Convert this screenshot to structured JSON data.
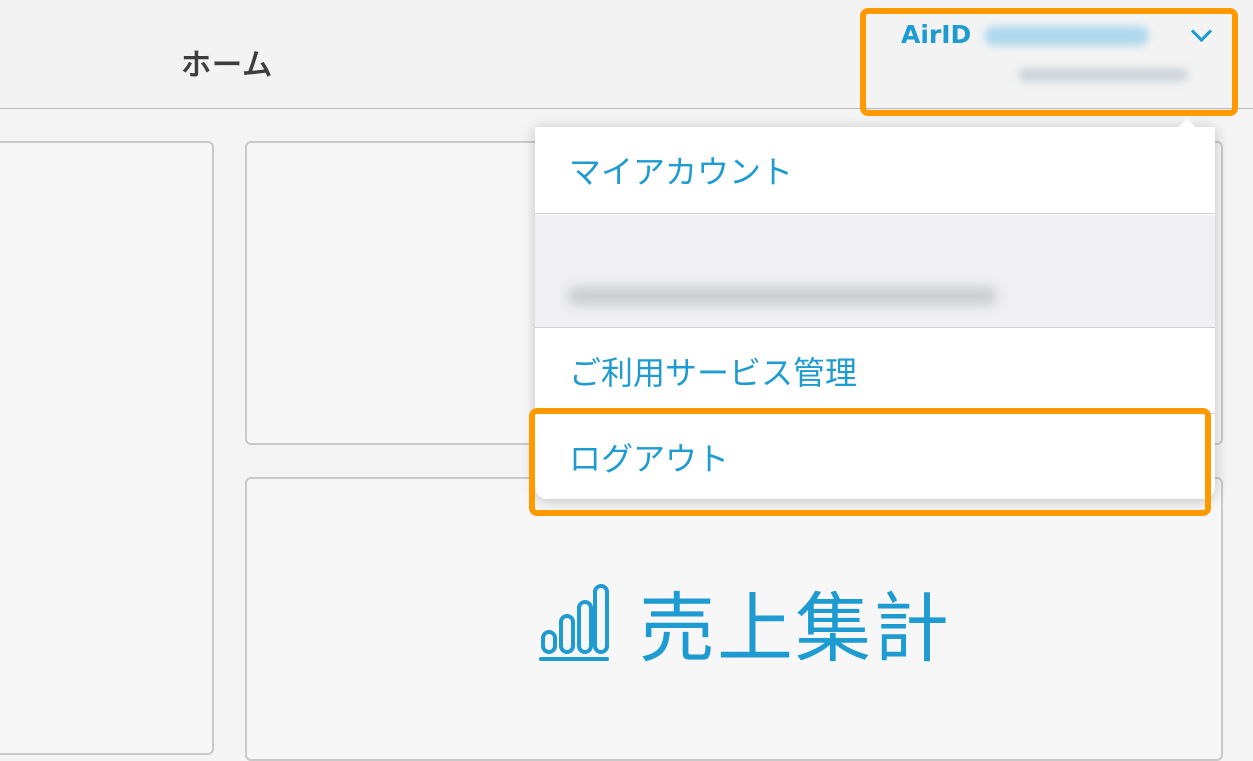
{
  "header": {
    "title": "ホーム",
    "airid_label": "AirID",
    "user_id": "",
    "account_subtext": ""
  },
  "dropdown": {
    "items": [
      {
        "label": "マイアカウント"
      },
      {
        "label": "ご利用サービス管理"
      },
      {
        "label": "ログアウト"
      }
    ],
    "blurred_info": ""
  },
  "tiles": {
    "sales_label": "売上集計"
  },
  "colors": {
    "accent": "#1e9bd0",
    "highlight": "#ff9900",
    "header_bg": "#f3f3f3"
  },
  "icons": {
    "dropdown_toggle": "chevron-down-icon",
    "sales": "bar-chart-icon"
  }
}
